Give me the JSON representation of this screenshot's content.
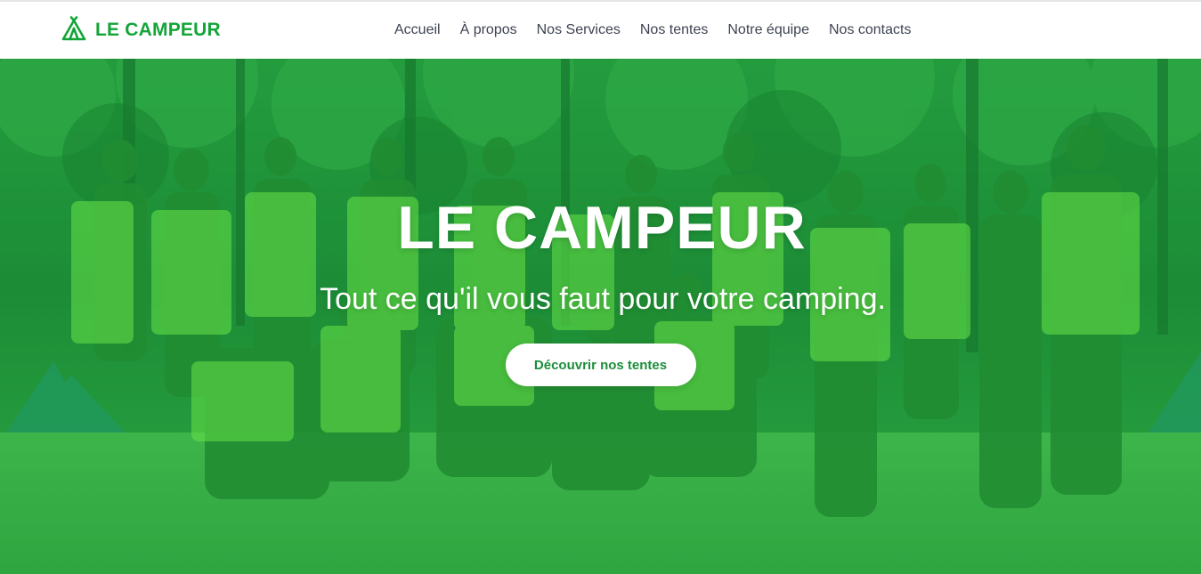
{
  "brand": {
    "name": "LE CAMPEUR",
    "icon": "tent-icon",
    "color": "#13a538"
  },
  "nav": {
    "items": [
      {
        "label": "Accueil"
      },
      {
        "label": "À propos"
      },
      {
        "label": "Nos Services"
      },
      {
        "label": "Nos tentes"
      },
      {
        "label": "Notre équipe"
      },
      {
        "label": "Nos contacts"
      }
    ]
  },
  "hero": {
    "title": "LE CAMPEUR",
    "subtitle": "Tout ce qu'il vous faut pour votre camping.",
    "cta_label": "Découvrir nos tentes",
    "overlay_color": "#08be3c"
  }
}
